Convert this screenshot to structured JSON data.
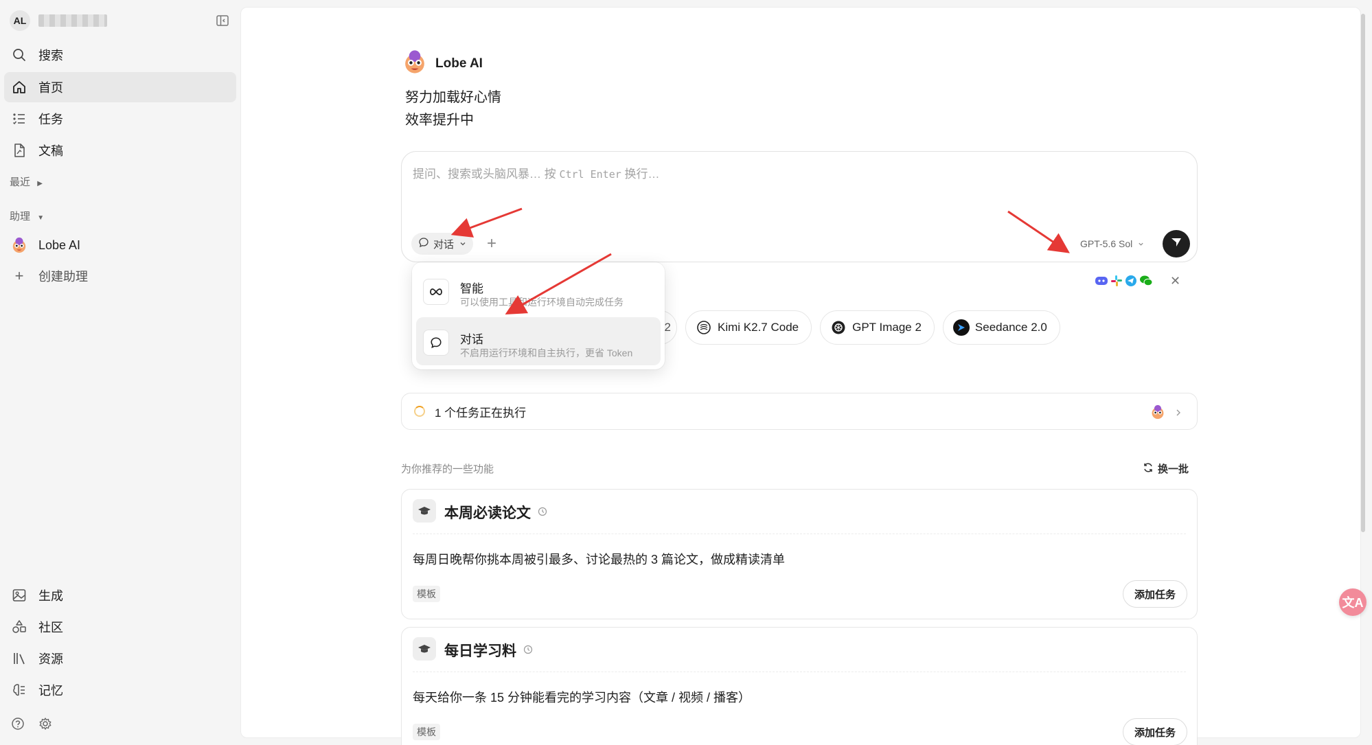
{
  "user": {
    "avatar_initials": "AL",
    "name_redacted": "▒▒▒▒▒▒▒▒"
  },
  "sidebar": {
    "items": [
      {
        "label": "搜索"
      },
      {
        "label": "首页"
      },
      {
        "label": "任务"
      },
      {
        "label": "文稿"
      }
    ],
    "recent_label": "最近",
    "assistant_label": "助理",
    "assistant_items": [
      {
        "label": "Lobe AI"
      },
      {
        "label": "创建助理"
      }
    ],
    "bottom_items": [
      {
        "label": "生成"
      },
      {
        "label": "社区"
      },
      {
        "label": "资源"
      },
      {
        "label": "记忆"
      }
    ]
  },
  "agent": {
    "name": "Lobe AI",
    "greeting_line1": "努力加载好心情",
    "greeting_line2": "效率提升中"
  },
  "input": {
    "placeholder_pre": "提问、搜索或头脑风暴… 按 ",
    "placeholder_kbd": "Ctrl Enter",
    "placeholder_post": " 换行…",
    "mode_label": "对话",
    "model_label": "GPT-5.6 Sol"
  },
  "dropdown": {
    "items": [
      {
        "title": "智能",
        "desc": "可以使用工具和运行环境自动完成任务"
      },
      {
        "title": "对话",
        "desc": "不启用运行环境和自主执行，更省 Token"
      }
    ]
  },
  "chips": [
    {
      "label": "2"
    },
    {
      "label": "Kimi K2.7 Code"
    },
    {
      "label": "GPT Image 2"
    },
    {
      "label": "Seedance 2.0"
    }
  ],
  "task_status": {
    "label": "1 个任务正在执行"
  },
  "recommend": {
    "title": "为你推荐的一些功能",
    "refresh_label": "换一批",
    "cards": [
      {
        "title": "本周必读论文",
        "desc": "每周日晚帮你挑本周被引最多、讨论最热的 3 篇论文，做成精读清单",
        "tag": "模板",
        "button": "添加任务"
      },
      {
        "title": "每日学习料",
        "desc": "每天给你一条 15 分钟能看完的学习内容（文章 / 视频 / 播客）",
        "tag": "模板",
        "button": "添加任务"
      }
    ]
  },
  "translate_button": "文A",
  "colors": {
    "accent_dark": "#1f1f1f",
    "arrow_red": "#e53935",
    "translate_pink": "#f28b9a"
  }
}
